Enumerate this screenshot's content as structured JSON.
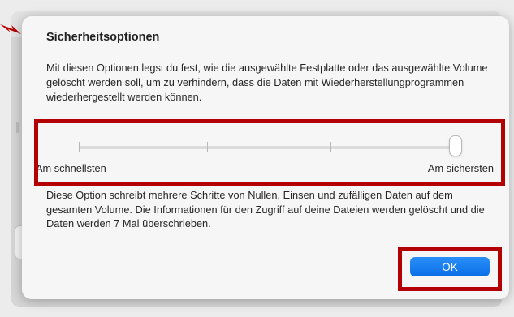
{
  "dialog": {
    "title": "Sicherheitsoptionen",
    "description": "Mit diesen Optionen legst du fest, wie die ausgewählte Festplatte oder das ausgewählte Volume gelöscht werden soll, um zu verhindern, dass die Daten mit Wiederherstellungprogrammen wiederhergestellt werden können.",
    "slider": {
      "min_label": "Am schnellsten",
      "max_label": "Am sichersten",
      "steps": 4,
      "selected_step": 4
    },
    "option_detail": "Diese Option schreibt mehrere Schritte von Nullen, Einsen und zufälligen Daten auf dem gesamten Volume. Die Informationen für den Zugriff auf deine Dateien werden gelöscht und die Daten werden 7 Mal überschrieben.",
    "ok_label": "OK"
  },
  "annotations": {
    "highlight_color": "#b30000",
    "accent_color": "#0a6fe6"
  }
}
